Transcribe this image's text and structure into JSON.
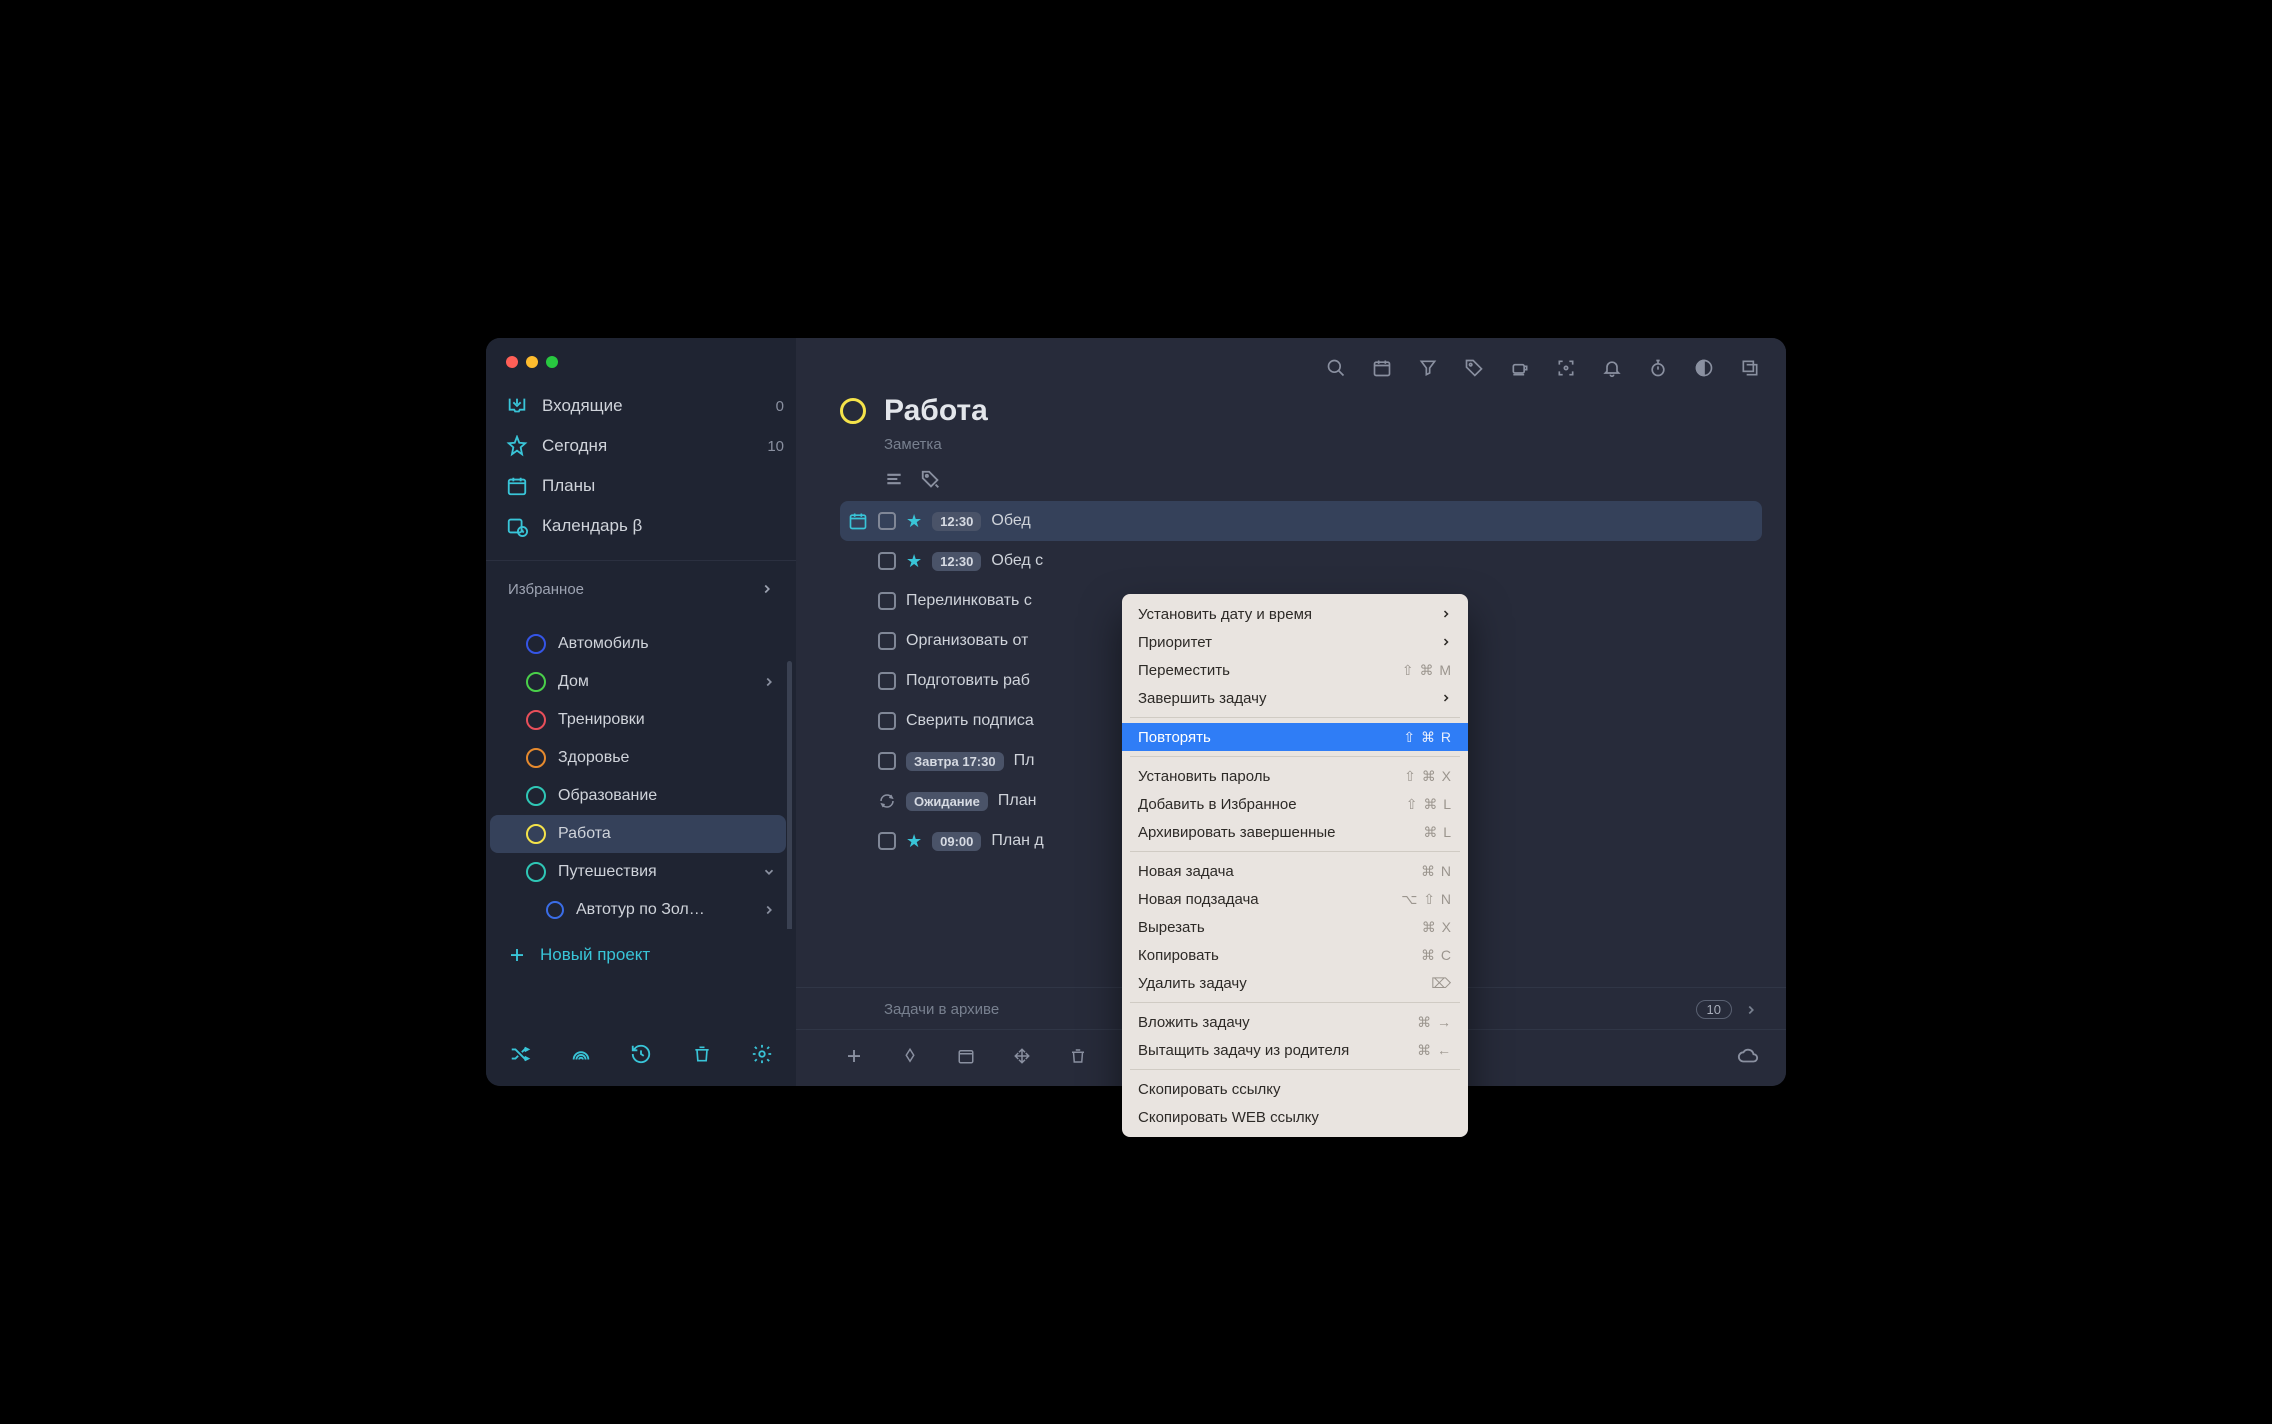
{
  "sidebar": {
    "nav": {
      "inbox": "Входящие",
      "inbox_count": "0",
      "today": "Сегодня",
      "today_count": "10",
      "plans": "Планы",
      "calendar": "Календарь β"
    },
    "section_hdr": "Избранное",
    "projects": [
      {
        "name": "Автомобиль",
        "color": "#3555e6",
        "arrow": false,
        "sub": false
      },
      {
        "name": "Дом",
        "color": "#4ad04a",
        "arrow": true,
        "sub": false
      },
      {
        "name": "Тренировки",
        "color": "#e84f5a",
        "arrow": false,
        "sub": false
      },
      {
        "name": "Здоровье",
        "color": "#e68a2e",
        "arrow": false,
        "sub": false
      },
      {
        "name": "Образование",
        "color": "#2fc7b6",
        "arrow": false,
        "sub": false
      },
      {
        "name": "Работа",
        "color": "#f5e34a",
        "arrow": false,
        "sub": false,
        "active": true
      },
      {
        "name": "Путешествия",
        "color": "#2fc7b6",
        "arrow": true,
        "sub": false,
        "arrow_down": true
      },
      {
        "name": "Автотур по Зол…",
        "color": "#3a6de8",
        "arrow": true,
        "sub": true
      }
    ],
    "new_project": "Новый проект"
  },
  "header": {
    "title": "Работа",
    "note": "Заметка"
  },
  "tasks": [
    {
      "cal": true,
      "star": true,
      "badge": "12:30",
      "title": "Обед",
      "selected": true
    },
    {
      "cal": false,
      "star": true,
      "badge": "12:30",
      "title": "Обед с"
    },
    {
      "cal": false,
      "star": false,
      "badge": null,
      "title": "Перелинковать с"
    },
    {
      "cal": false,
      "star": false,
      "badge": null,
      "title": "Организовать от"
    },
    {
      "cal": false,
      "star": false,
      "badge": null,
      "title": "Подготовить раб"
    },
    {
      "cal": false,
      "star": false,
      "badge": null,
      "title": "Сверить подписа"
    },
    {
      "cal": false,
      "star": false,
      "badge": "Завтра 17:30",
      "title": "Пл"
    },
    {
      "cal": false,
      "star": false,
      "badge": "Ожидание",
      "title": "План",
      "repeat": true
    },
    {
      "cal": false,
      "star": true,
      "badge": "09:00",
      "title": "План д"
    }
  ],
  "archive": {
    "label": "Задачи в архиве",
    "count": "10"
  },
  "context_menu": [
    {
      "type": "item",
      "label": "Установить дату и время",
      "sub": true
    },
    {
      "type": "item",
      "label": "Приоритет",
      "sub": true
    },
    {
      "type": "item",
      "label": "Переместить",
      "shortcut": "⇧ ⌘ M"
    },
    {
      "type": "item",
      "label": "Завершить задачу",
      "sub": true
    },
    {
      "type": "sep"
    },
    {
      "type": "item",
      "label": "Повторять",
      "shortcut": "⇧ ⌘ R",
      "hi": true
    },
    {
      "type": "sep"
    },
    {
      "type": "item",
      "label": "Установить пароль",
      "shortcut": "⇧ ⌘ X"
    },
    {
      "type": "item",
      "label": "Добавить в Избранное",
      "shortcut": "⇧ ⌘ L"
    },
    {
      "type": "item",
      "label": "Архивировать завершенные",
      "shortcut": "⌘ L"
    },
    {
      "type": "sep"
    },
    {
      "type": "item",
      "label": "Новая задача",
      "shortcut": "⌘ N"
    },
    {
      "type": "item",
      "label": "Новая подзадача",
      "shortcut": "⌥ ⇧ N"
    },
    {
      "type": "item",
      "label": "Вырезать",
      "shortcut": "⌘ X"
    },
    {
      "type": "item",
      "label": "Копировать",
      "shortcut": "⌘ C"
    },
    {
      "type": "item",
      "label": "Удалить задачу",
      "shortcut": "⌦"
    },
    {
      "type": "sep"
    },
    {
      "type": "item",
      "label": "Вложить задачу",
      "shortcut": "⌘ →"
    },
    {
      "type": "item",
      "label": "Вытащить задачу из родителя",
      "shortcut": "⌘ ←"
    },
    {
      "type": "sep"
    },
    {
      "type": "item",
      "label": "Скопировать ссылку"
    },
    {
      "type": "item",
      "label": "Скопировать WEB ссылку"
    }
  ]
}
